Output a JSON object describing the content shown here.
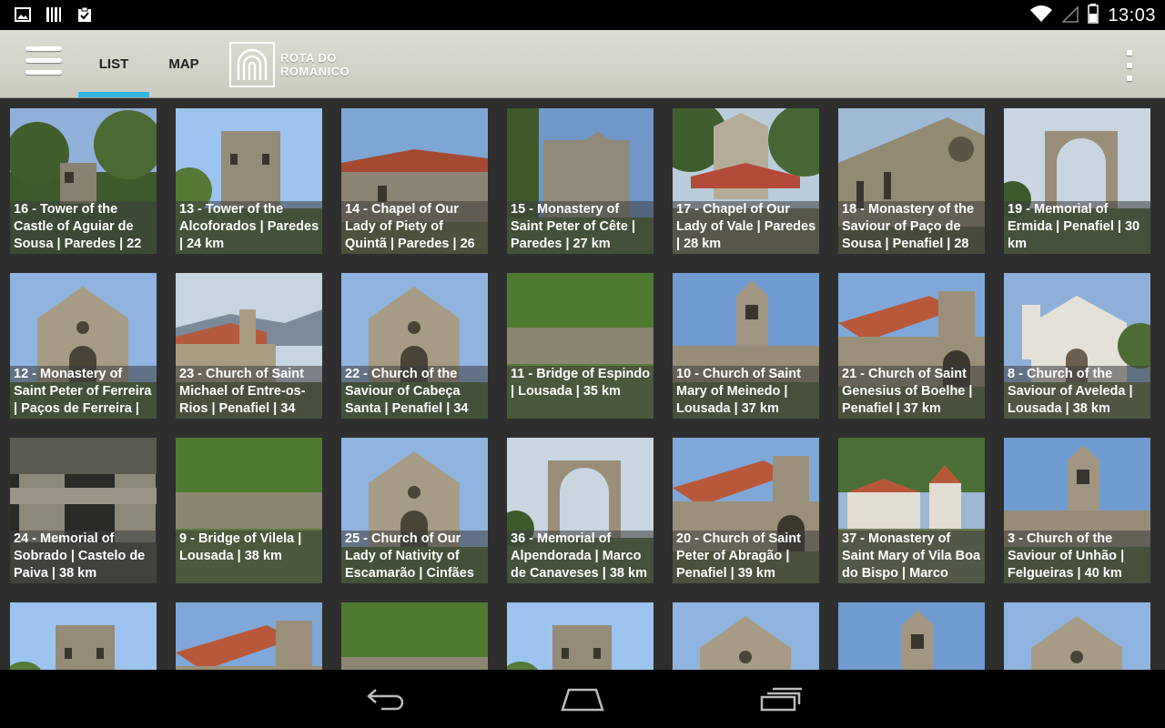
{
  "status_bar": {
    "time": "13:03",
    "icons": [
      "image-icon",
      "barcode-icon",
      "clipboard-check-icon",
      "wifi-icon",
      "signal-icon",
      "battery-icon"
    ]
  },
  "action_bar": {
    "tabs": [
      {
        "label": "LIST",
        "selected": true
      },
      {
        "label": "MAP",
        "selected": false
      }
    ],
    "logo": {
      "line1": "ROTA DO",
      "line2": "ROMÂNICO"
    }
  },
  "colors": {
    "accent": "#33b5e5",
    "action_bar": "#d4d4ca",
    "background": "#2e2e2e"
  },
  "tiles": [
    {
      "caption": "16 - Tower of the Castle of Aguiar de Sousa  | Paredes | 22",
      "scene": "tower-forest"
    },
    {
      "caption": "13 - Tower of the Alcoforados  | Paredes | 24 km",
      "scene": "tower-sky"
    },
    {
      "caption": "14 - Chapel of Our Lady of Piety of Quintã  | Paredes | 26",
      "scene": "chapel-roof"
    },
    {
      "caption": "15 - Monastery of Saint Peter of Cête | Paredes | 27 km",
      "scene": "monastery-tree"
    },
    {
      "caption": "17 - Chapel of Our Lady of Vale | Paredes | 28 km",
      "scene": "chapel-trees"
    },
    {
      "caption": "18 - Monastery of the Saviour of Paço de Sousa  | Penafiel | 28",
      "scene": "monastery-stone"
    },
    {
      "caption": "19 - Memorial of Ermida | Penafiel | 30 km",
      "scene": "memorial-arch"
    },
    {
      "caption": "12 - Monastery of Saint Peter of Ferreira | Paços de Ferreira |",
      "scene": "church-stone"
    },
    {
      "caption": "23 - Church of Saint Michael of Entre-os-Rios | Penafiel | 34",
      "scene": "church-hills"
    },
    {
      "caption": "22 - Church of the Saviour of Cabeça Santa  | Penafiel | 34",
      "scene": "church-stone"
    },
    {
      "caption": "11 - Bridge of Espindo | Lousada | 35 km",
      "scene": "bridge-green"
    },
    {
      "caption": "10 - Church of Saint Mary of Meinedo | Lousada | 37 km",
      "scene": "bell-tower"
    },
    {
      "caption": "21 - Church of Saint Genesius of Boelhe  | Penafiel | 37 km",
      "scene": "church-roof"
    },
    {
      "caption": "8 - Church of the Saviour of Aveleda | Lousada | 38 km",
      "scene": "white-church"
    },
    {
      "caption": "24 - Memorial of Sobrado | Castelo de Paiva | 38 km",
      "scene": "memorial-dark"
    },
    {
      "caption": "9 - Bridge of Vilela  | Lousada | 38 km",
      "scene": "bridge-green"
    },
    {
      "caption": "25 - Church of Our Lady of Nativity of Escamarão  | Cinfães",
      "scene": "church-stone"
    },
    {
      "caption": "36 - Memorial of Alpendorada  | Marco de Canaveses | 38 km",
      "scene": "memorial-arch"
    },
    {
      "caption": "20 - Church of Saint Peter of Abragão  | Penafiel | 39 km",
      "scene": "church-roof"
    },
    {
      "caption": "37 - Monastery of Saint Mary of Vila Boa do Bispo  | Marco",
      "scene": "village"
    },
    {
      "caption": "3 - Church of the Saviour of Unhão | Felgueiras | 40 km",
      "scene": "bell-tower"
    },
    {
      "caption": "",
      "scene": "tower-sky"
    },
    {
      "caption": "",
      "scene": "church-roof"
    },
    {
      "caption": "",
      "scene": "bridge-green"
    },
    {
      "caption": "",
      "scene": "tower-sky"
    },
    {
      "caption": "",
      "scene": "church-stone"
    },
    {
      "caption": "",
      "scene": "bell-tower"
    },
    {
      "caption": "",
      "scene": "church-stone"
    }
  ],
  "nav_bar": {
    "buttons": [
      "back-icon",
      "home-icon",
      "recents-icon"
    ]
  }
}
